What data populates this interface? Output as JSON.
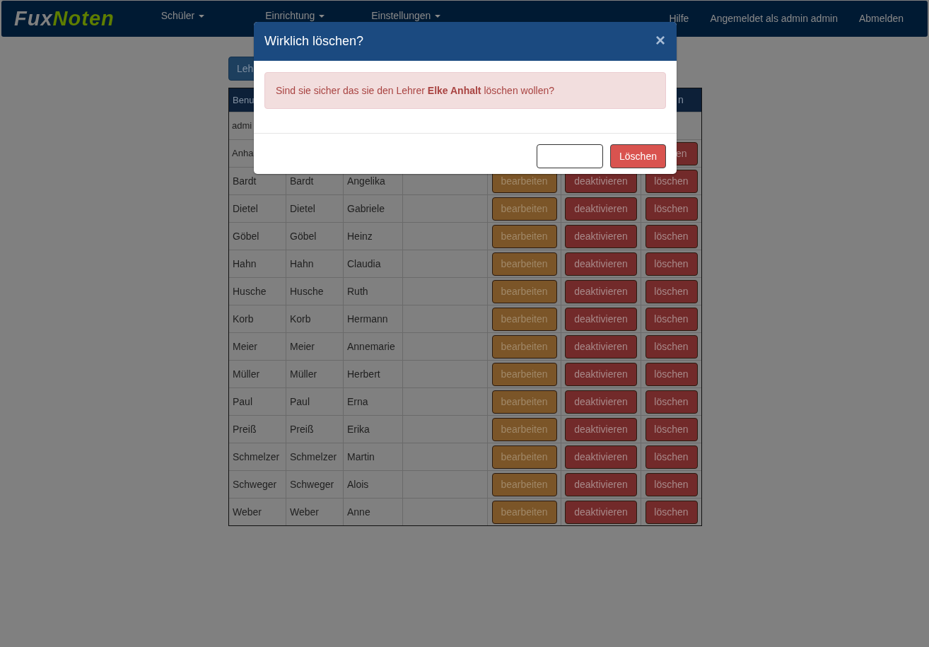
{
  "navbar": {
    "brand": {
      "first": "Fux",
      "second": "Noten"
    },
    "menus": [
      {
        "label": "Schüler",
        "dropdown": true
      },
      {
        "label": "Einrichtung",
        "dropdown": true
      },
      {
        "label": "Einstellungen",
        "dropdown": true
      }
    ],
    "right_links": [
      "Hilfe",
      "Angemeldet als admin admin",
      "Abmelden"
    ]
  },
  "add_button": "Leh",
  "table": {
    "header": {
      "column_1": "Benu",
      "column_7": "n"
    },
    "rows": [
      {
        "cells": [
          "admi"
        ],
        "buttons": []
      },
      {
        "cells": [
          "Anha"
        ],
        "buttons": [
          {
            "kind": "delete",
            "label": "en"
          }
        ]
      },
      {
        "cells": [
          "Bardt",
          "Bardt",
          "Angelika",
          ""
        ],
        "buttons": [
          {
            "kind": "edit",
            "label": "bearbeiten"
          },
          {
            "kind": "deactivate",
            "label": "deaktivieren"
          },
          {
            "kind": "delete",
            "label": "löschen"
          }
        ]
      },
      {
        "cells": [
          "Dietel",
          "Dietel",
          "Gabriele",
          ""
        ],
        "buttons": [
          {
            "kind": "edit",
            "label": "bearbeiten"
          },
          {
            "kind": "deactivate",
            "label": "deaktivieren"
          },
          {
            "kind": "delete",
            "label": "löschen"
          }
        ]
      },
      {
        "cells": [
          "Göbel",
          "Göbel",
          "Heinz",
          ""
        ],
        "buttons": [
          {
            "kind": "edit",
            "label": "bearbeiten"
          },
          {
            "kind": "deactivate",
            "label": "deaktivieren"
          },
          {
            "kind": "delete",
            "label": "löschen"
          }
        ]
      },
      {
        "cells": [
          "Hahn",
          "Hahn",
          "Claudia",
          ""
        ],
        "buttons": [
          {
            "kind": "edit",
            "label": "bearbeiten"
          },
          {
            "kind": "deactivate",
            "label": "deaktivieren"
          },
          {
            "kind": "delete",
            "label": "löschen"
          }
        ]
      },
      {
        "cells": [
          "Husche",
          "Husche",
          "Ruth",
          ""
        ],
        "buttons": [
          {
            "kind": "edit",
            "label": "bearbeiten"
          },
          {
            "kind": "deactivate",
            "label": "deaktivieren"
          },
          {
            "kind": "delete",
            "label": "löschen"
          }
        ]
      },
      {
        "cells": [
          "Korb",
          "Korb",
          "Hermann",
          ""
        ],
        "buttons": [
          {
            "kind": "edit",
            "label": "bearbeiten"
          },
          {
            "kind": "deactivate",
            "label": "deaktivieren"
          },
          {
            "kind": "delete",
            "label": "löschen"
          }
        ]
      },
      {
        "cells": [
          "Meier",
          "Meier",
          "Annemarie",
          ""
        ],
        "buttons": [
          {
            "kind": "edit",
            "label": "bearbeiten"
          },
          {
            "kind": "deactivate",
            "label": "deaktivieren"
          },
          {
            "kind": "delete",
            "label": "löschen"
          }
        ]
      },
      {
        "cells": [
          "Müller",
          "Müller",
          "Herbert",
          ""
        ],
        "buttons": [
          {
            "kind": "edit",
            "label": "bearbeiten"
          },
          {
            "kind": "deactivate",
            "label": "deaktivieren"
          },
          {
            "kind": "delete",
            "label": "löschen"
          }
        ]
      },
      {
        "cells": [
          "Paul",
          "Paul",
          "Erna",
          ""
        ],
        "buttons": [
          {
            "kind": "edit",
            "label": "bearbeiten"
          },
          {
            "kind": "deactivate",
            "label": "deaktivieren"
          },
          {
            "kind": "delete",
            "label": "löschen"
          }
        ]
      },
      {
        "cells": [
          "Preiß",
          "Preiß",
          "Erika",
          ""
        ],
        "buttons": [
          {
            "kind": "edit",
            "label": "bearbeiten"
          },
          {
            "kind": "deactivate",
            "label": "deaktivieren"
          },
          {
            "kind": "delete",
            "label": "löschen"
          }
        ]
      },
      {
        "cells": [
          "Schmelzer",
          "Schmelzer",
          "Martin",
          ""
        ],
        "buttons": [
          {
            "kind": "edit",
            "label": "bearbeiten"
          },
          {
            "kind": "deactivate",
            "label": "deaktivieren"
          },
          {
            "kind": "delete",
            "label": "löschen"
          }
        ]
      },
      {
        "cells": [
          "Schweger",
          "Schweger",
          "Alois",
          ""
        ],
        "buttons": [
          {
            "kind": "edit",
            "label": "bearbeiten"
          },
          {
            "kind": "deactivate",
            "label": "deaktivieren"
          },
          {
            "kind": "delete",
            "label": "löschen"
          }
        ]
      },
      {
        "cells": [
          "Weber",
          "Weber",
          "Anne",
          ""
        ],
        "buttons": [
          {
            "kind": "edit",
            "label": "bearbeiten"
          },
          {
            "kind": "deactivate",
            "label": "deaktivieren"
          },
          {
            "kind": "delete",
            "label": "löschen"
          }
        ]
      }
    ]
  },
  "modal": {
    "title": "Wirklich löschen?",
    "close": "×",
    "message": "Sind sie sicher das sie den Lehrer **Elke Anhalt** löschen wollen?",
    "confirm_button": "Löschen"
  }
}
